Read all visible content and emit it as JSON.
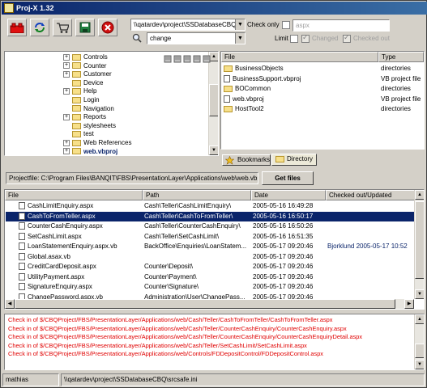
{
  "window": {
    "title": "Proj-X 1.32"
  },
  "toolbar": {
    "icons": [
      "lego-icon",
      "refresh-icon",
      "cart-icon",
      "save-icon",
      "stop-icon"
    ]
  },
  "path_combo": {
    "value": "\\\\qatardev\\project\\SSDatabaseCBQ\\srcsafe.ini"
  },
  "search_combo": {
    "value": "change"
  },
  "check_only": {
    "label": "Check only",
    "value": "aspx",
    "checked": false
  },
  "limit": {
    "label": "Limit",
    "checked": false
  },
  "changed": {
    "label": "Changed",
    "checked": true
  },
  "checked_out": {
    "label": "Checked out",
    "checked": true
  },
  "tree": {
    "items": [
      {
        "label": "Controls",
        "expander": "+"
      },
      {
        "label": "Counter",
        "expander": "+"
      },
      {
        "label": "Customer",
        "expander": "+"
      },
      {
        "label": "Device",
        "expander": ""
      },
      {
        "label": "Help",
        "expander": "+"
      },
      {
        "label": "Login",
        "expander": ""
      },
      {
        "label": "Navigation",
        "expander": ""
      },
      {
        "label": "Reports",
        "expander": "+"
      },
      {
        "label": "stylesheets",
        "expander": ""
      },
      {
        "label": "test",
        "expander": ""
      },
      {
        "label": "Web References",
        "expander": "+"
      },
      {
        "label": "web.vbproj",
        "expander": "+"
      }
    ]
  },
  "dir_list": {
    "headers": {
      "file": "File",
      "type": "Type"
    },
    "rows": [
      {
        "file": "BusinessObjects",
        "type": "directories",
        "icon": "folder"
      },
      {
        "file": "BusinessSupport.vbproj",
        "type": "VB project file",
        "icon": "project"
      },
      {
        "file": "BOCommon",
        "type": "directories",
        "icon": "folder"
      },
      {
        "file": "web.vbproj",
        "type": "VB project file",
        "icon": "project"
      },
      {
        "file": "HostTool2",
        "type": "directories",
        "icon": "folder"
      }
    ]
  },
  "tabs": {
    "bookmarks": "Bookmarks",
    "directory": "Directory"
  },
  "projectfile": {
    "value": "Projectfile: C:\\Program Files\\BANQIT\\FBS\\PresentationLayer\\Applications\\web\\web.vbproj",
    "button": "Get files"
  },
  "file_list": {
    "headers": {
      "file": "File",
      "path": "Path",
      "date": "Date",
      "checked": "Checked out/Updated"
    },
    "rows": [
      {
        "file": "CashLimitEnquiry.aspx",
        "path": "Cash\\Teller\\CashLimitEnquiry\\",
        "date": "2005-05-16 16:49:28",
        "checked": ""
      },
      {
        "file": "CashToFromTeller.aspx",
        "path": "Cash\\Teller\\CashToFromTeller\\",
        "date": "2005-05-16 16:50:17",
        "checked": ""
      },
      {
        "file": "CounterCashEnquiry.aspx",
        "path": "Cash\\Teller\\CounterCashEnquiry\\",
        "date": "2005-05-16 16:50:26",
        "checked": ""
      },
      {
        "file": "SetCashLimit.aspx",
        "path": "Cash\\Teller\\SetCashLimit\\",
        "date": "2005-05-16 16:51:35",
        "checked": ""
      },
      {
        "file": "LoanStatementEnquiry.aspx.vb",
        "path": "BackOffice\\Enquiries\\LoanStatem...",
        "date": "2005-05-17 09:20:46",
        "checked": "Bjorklund 2005-05-17 10:52"
      },
      {
        "file": "Global.asax.vb",
        "path": "",
        "date": "2005-05-17 09:20:46",
        "checked": ""
      },
      {
        "file": "CreditCardDeposit.aspx",
        "path": "Counter\\Deposit\\",
        "date": "2005-05-17 09:20:46",
        "checked": ""
      },
      {
        "file": "UtilityPayment.aspx",
        "path": "Counter\\Payment\\",
        "date": "2005-05-17 09:20:46",
        "checked": ""
      },
      {
        "file": "SignatureEnquiry.aspx",
        "path": "Counter\\Signature\\",
        "date": "2005-05-17 09:20:46",
        "checked": ""
      },
      {
        "file": "ChangePassword.aspx.vb",
        "path": "Administration\\User\\ChangePass...",
        "date": "2005-05-17 09:20:46",
        "checked": ""
      }
    ],
    "selected_index": 1
  },
  "log": {
    "lines": [
      "Check in of $/CBQProject/FBS/PresentationLayer/Applications/web/Cash/Teller/CashToFromTeller/CashToFromTeller.aspx",
      "Check in of $/CBQProject/FBS/PresentationLayer/Applications/web/Cash/Teller/CounterCashEnquiry/CounterCashEnquiry.aspx",
      "Check in of $/CBQProject/FBS/PresentationLayer/Applications/web/Cash/Teller/CounterCashEnquiry/CounterCashEnquiryDetail.aspx",
      "Check in of $/CBQProject/FBS/PresentationLayer/Applications/web/Cash/Teller/SetCashLimit/SetCashLimit.aspx",
      "Check in of $/CBQProject/FBS/PresentationLayer/Applications/web/Controls/FDDepositControl/FDDepositControl.aspx"
    ],
    "color": "#e00000"
  },
  "status": {
    "user": "mathias",
    "ini": "\\\\qatardev\\project\\SSDatabaseCBQ\\srcsafe.ini"
  },
  "colors": {
    "title_bar": "#0a246a",
    "selection": "#0a246a",
    "chrome": "#d4d0c8"
  }
}
